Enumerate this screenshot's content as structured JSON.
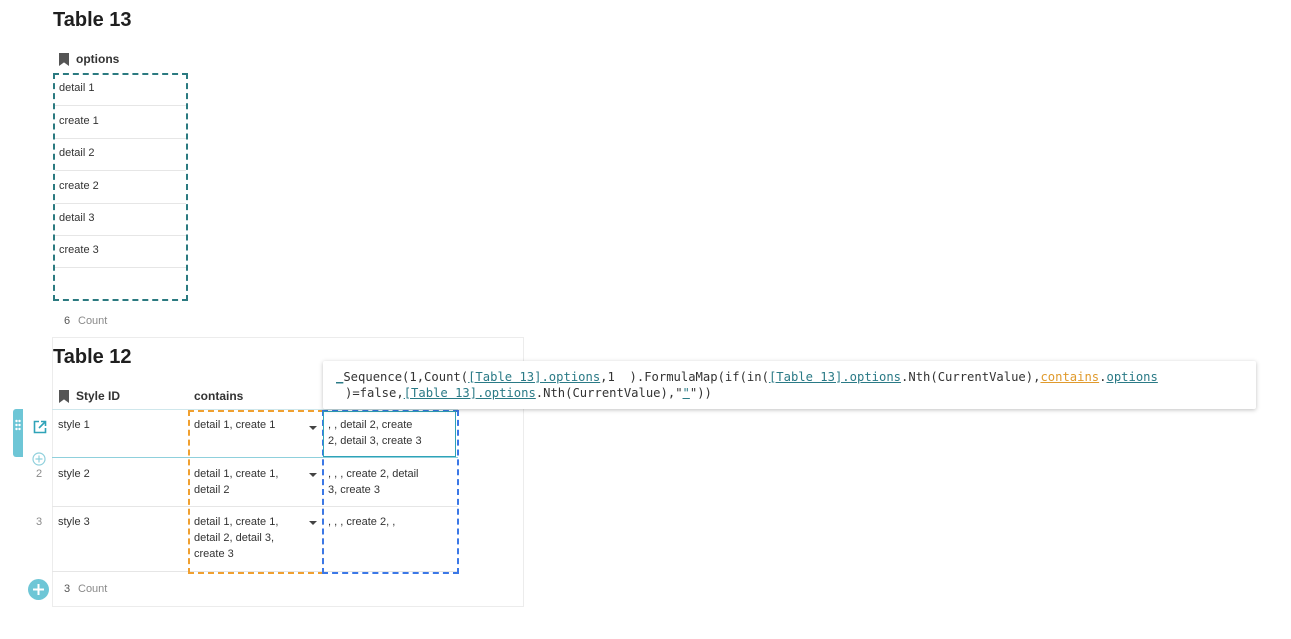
{
  "table13": {
    "title": "Table 13",
    "column": "options",
    "rows": [
      "detail 1",
      "create 1",
      "detail 2",
      "create 2",
      "detail 3",
      "create 3"
    ],
    "count_value": "6",
    "count_label": "Count"
  },
  "table12": {
    "title": "Table 12",
    "columns": {
      "style_id": "Style ID",
      "contains": "contains"
    },
    "rows": [
      {
        "num": "1",
        "style_id": "style 1",
        "contains": [
          "detail 1, create 1"
        ],
        "formula": [
          ", , detail 2, create",
          "2, detail 3, create 3"
        ]
      },
      {
        "num": "2",
        "style_id": "style 2",
        "contains": [
          "detail 1, create 1,",
          "detail 2"
        ],
        "formula": [
          ", , , create 2, detail",
          "3, create 3"
        ]
      },
      {
        "num": "3",
        "style_id": "style 3",
        "contains": [
          "detail 1, create 1,",
          "detail 2, detail 3,",
          "create 3"
        ],
        "formula": [
          ", , , create 2, ,"
        ]
      }
    ],
    "count_value": "3",
    "count_label": "Count"
  },
  "formula_editor": {
    "prefix": "_",
    "l1_a": "Sequence(1,Count(",
    "l1_ref1": "[Table 13].options",
    "l1_b": ",1  ).FormulaMap(if(in(",
    "l1_ref2": "[Table 13].options",
    "l1_c": ".Nth(CurrentValue),",
    "l1_ref3": "contains",
    "l1_d": ".",
    "l1_ref4": "options",
    "l2_a": ")=false,",
    "l2_ref1": "[Table 13].options",
    "l2_b": ".Nth(CurrentValue),\"",
    "l2_ref2": "\"",
    "l2_c": "\"))"
  },
  "colors": {
    "teal_dash": "#2b7a80",
    "orange_dash": "#f0a030",
    "blue_dash": "#3b78e7",
    "accent": "#6ec6d6"
  },
  "icons": [
    "bookmark-icon",
    "open-row-icon",
    "drag-handle-icon",
    "add-circle-icon",
    "dropdown-caret-icon"
  ]
}
